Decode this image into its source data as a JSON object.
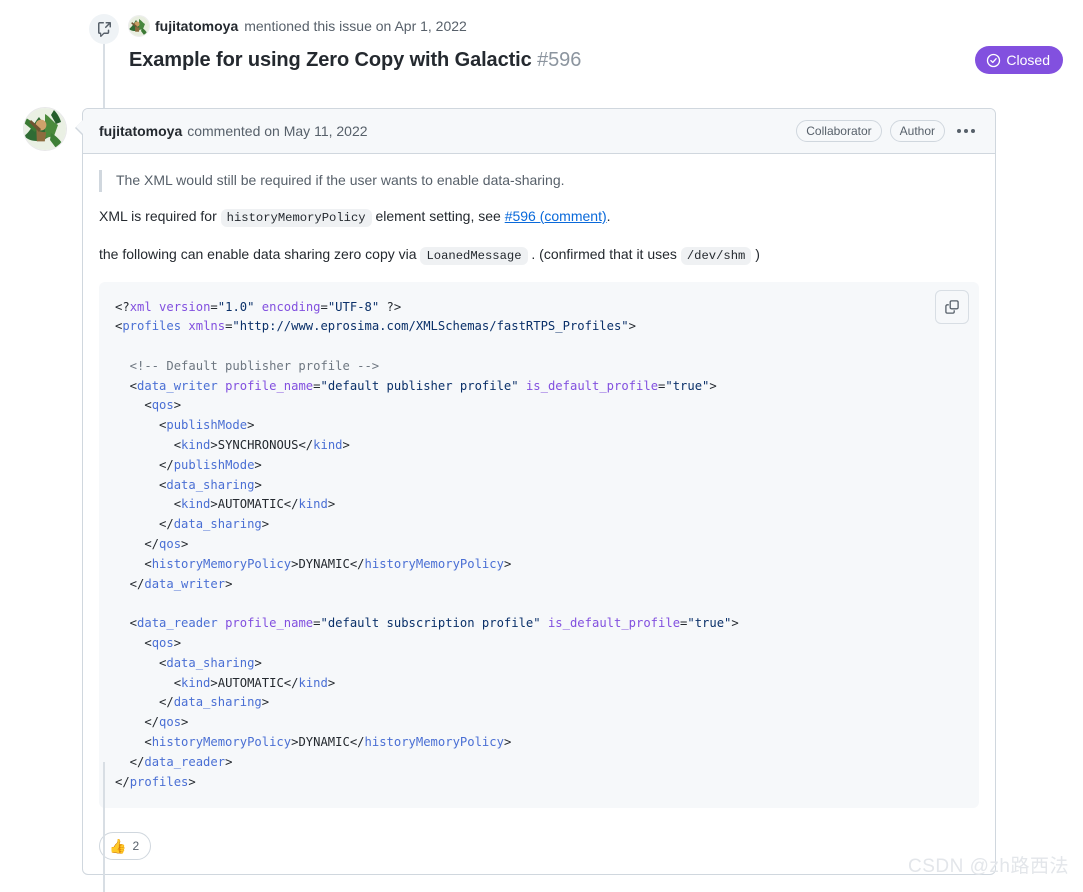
{
  "cross_reference": {
    "icon": "cross-reference-icon",
    "user": "fujitatomoya",
    "action": "mentioned this issue on Apr 1, 2022",
    "issue_title": "Example for using Zero Copy with Galactic",
    "issue_number": "#596",
    "status": {
      "label": "Closed",
      "icon": "check-circle-icon",
      "color": "#8250df"
    }
  },
  "comment": {
    "author": "fujitatomoya",
    "meta": "commented on May 11, 2022",
    "badges": [
      "Collaborator",
      "Author"
    ],
    "menu_icon": "kebab-horizontal-icon",
    "blockquote": "The XML would still be required if the user wants to enable data-sharing.",
    "paragraph_2": {
      "before": "XML is required for",
      "code": "historyMemoryPolicy",
      "middle": "element setting, see",
      "link": "#596 (comment)",
      "after": "."
    },
    "paragraph_3": {
      "before": "the following can enable data sharing zero copy via",
      "code1": "LoanedMessage",
      "middle": ". (confirmed that it uses",
      "code2": "/dev/shm",
      "after": ")"
    },
    "code_block": {
      "language": "xml",
      "copy_button_label": "Copy",
      "copy_icon": "copy-icon",
      "lines": [
        [
          [
            "tk-punct",
            "<?"
          ],
          [
            "tk-decl",
            "xml "
          ],
          [
            "tk-attr",
            "version"
          ],
          [
            "tk-punct",
            "="
          ],
          [
            "tk-str",
            "\"1.0\""
          ],
          [
            "tk-punct",
            " "
          ],
          [
            "tk-attr",
            "encoding"
          ],
          [
            "tk-punct",
            "="
          ],
          [
            "tk-str",
            "\"UTF-8\""
          ],
          [
            "tk-punct",
            " ?>"
          ]
        ],
        [
          [
            "tk-punct",
            "<"
          ],
          [
            "tk-tag",
            "profiles"
          ],
          [
            "tk-punct",
            " "
          ],
          [
            "tk-attr",
            "xmlns"
          ],
          [
            "tk-punct",
            "="
          ],
          [
            "tk-str",
            "\"http://www.eprosima.com/XMLSchemas/fastRTPS_Profiles\""
          ],
          [
            "tk-punct",
            ">"
          ]
        ],
        [
          [
            "tk-punct",
            ""
          ]
        ],
        [
          [
            "tk-cmt",
            "  <!-- Default publisher profile -->"
          ]
        ],
        [
          [
            "tk-punct",
            "  <"
          ],
          [
            "tk-tag",
            "data_writer"
          ],
          [
            "tk-punct",
            " "
          ],
          [
            "tk-attr",
            "profile_name"
          ],
          [
            "tk-punct",
            "="
          ],
          [
            "tk-str",
            "\"default publisher profile\""
          ],
          [
            "tk-punct",
            " "
          ],
          [
            "tk-attr",
            "is_default_profile"
          ],
          [
            "tk-punct",
            "="
          ],
          [
            "tk-str",
            "\"true\""
          ],
          [
            "tk-punct",
            ">"
          ]
        ],
        [
          [
            "tk-punct",
            "    <"
          ],
          [
            "tk-tag",
            "qos"
          ],
          [
            "tk-punct",
            ">"
          ]
        ],
        [
          [
            "tk-punct",
            "      <"
          ],
          [
            "tk-tag",
            "publishMode"
          ],
          [
            "tk-punct",
            ">"
          ]
        ],
        [
          [
            "tk-punct",
            "        <"
          ],
          [
            "tk-tag",
            "kind"
          ],
          [
            "tk-punct",
            ">"
          ],
          [
            "tk-txt",
            "SYNCHRONOUS"
          ],
          [
            "tk-punct",
            "</"
          ],
          [
            "tk-tag",
            "kind"
          ],
          [
            "tk-punct",
            ">"
          ]
        ],
        [
          [
            "tk-punct",
            "      </"
          ],
          [
            "tk-tag",
            "publishMode"
          ],
          [
            "tk-punct",
            ">"
          ]
        ],
        [
          [
            "tk-punct",
            "      <"
          ],
          [
            "tk-tag",
            "data_sharing"
          ],
          [
            "tk-punct",
            ">"
          ]
        ],
        [
          [
            "tk-punct",
            "        <"
          ],
          [
            "tk-tag",
            "kind"
          ],
          [
            "tk-punct",
            ">"
          ],
          [
            "tk-txt",
            "AUTOMATIC"
          ],
          [
            "tk-punct",
            "</"
          ],
          [
            "tk-tag",
            "kind"
          ],
          [
            "tk-punct",
            ">"
          ]
        ],
        [
          [
            "tk-punct",
            "      </"
          ],
          [
            "tk-tag",
            "data_sharing"
          ],
          [
            "tk-punct",
            ">"
          ]
        ],
        [
          [
            "tk-punct",
            "    </"
          ],
          [
            "tk-tag",
            "qos"
          ],
          [
            "tk-punct",
            ">"
          ]
        ],
        [
          [
            "tk-punct",
            "    <"
          ],
          [
            "tk-tag",
            "historyMemoryPolicy"
          ],
          [
            "tk-punct",
            ">"
          ],
          [
            "tk-txt",
            "DYNAMIC"
          ],
          [
            "tk-punct",
            "</"
          ],
          [
            "tk-tag",
            "historyMemoryPolicy"
          ],
          [
            "tk-punct",
            ">"
          ]
        ],
        [
          [
            "tk-punct",
            "  </"
          ],
          [
            "tk-tag",
            "data_writer"
          ],
          [
            "tk-punct",
            ">"
          ]
        ],
        [
          [
            "tk-punct",
            ""
          ]
        ],
        [
          [
            "tk-punct",
            "  <"
          ],
          [
            "tk-tag",
            "data_reader"
          ],
          [
            "tk-punct",
            " "
          ],
          [
            "tk-attr",
            "profile_name"
          ],
          [
            "tk-punct",
            "="
          ],
          [
            "tk-str",
            "\"default subscription profile\""
          ],
          [
            "tk-punct",
            " "
          ],
          [
            "tk-attr",
            "is_default_profile"
          ],
          [
            "tk-punct",
            "="
          ],
          [
            "tk-str",
            "\"true\""
          ],
          [
            "tk-punct",
            ">"
          ]
        ],
        [
          [
            "tk-punct",
            "    <"
          ],
          [
            "tk-tag",
            "qos"
          ],
          [
            "tk-punct",
            ">"
          ]
        ],
        [
          [
            "tk-punct",
            "      <"
          ],
          [
            "tk-tag",
            "data_sharing"
          ],
          [
            "tk-punct",
            ">"
          ]
        ],
        [
          [
            "tk-punct",
            "        <"
          ],
          [
            "tk-tag",
            "kind"
          ],
          [
            "tk-punct",
            ">"
          ],
          [
            "tk-txt",
            "AUTOMATIC"
          ],
          [
            "tk-punct",
            "</"
          ],
          [
            "tk-tag",
            "kind"
          ],
          [
            "tk-punct",
            ">"
          ]
        ],
        [
          [
            "tk-punct",
            "      </"
          ],
          [
            "tk-tag",
            "data_sharing"
          ],
          [
            "tk-punct",
            ">"
          ]
        ],
        [
          [
            "tk-punct",
            "    </"
          ],
          [
            "tk-tag",
            "qos"
          ],
          [
            "tk-punct",
            ">"
          ]
        ],
        [
          [
            "tk-punct",
            "    <"
          ],
          [
            "tk-tag",
            "historyMemoryPolicy"
          ],
          [
            "tk-punct",
            ">"
          ],
          [
            "tk-txt",
            "DYNAMIC"
          ],
          [
            "tk-punct",
            "</"
          ],
          [
            "tk-tag",
            "historyMemoryPolicy"
          ],
          [
            "tk-punct",
            ">"
          ]
        ],
        [
          [
            "tk-punct",
            "  </"
          ],
          [
            "tk-tag",
            "data_reader"
          ],
          [
            "tk-punct",
            ">"
          ]
        ],
        [
          [
            "tk-punct",
            "</"
          ],
          [
            "tk-tag",
            "profiles"
          ],
          [
            "tk-punct",
            ">"
          ]
        ]
      ]
    },
    "reaction": {
      "emoji": "👍",
      "count": "2"
    }
  },
  "watermark": "CSDN @zh路西法"
}
